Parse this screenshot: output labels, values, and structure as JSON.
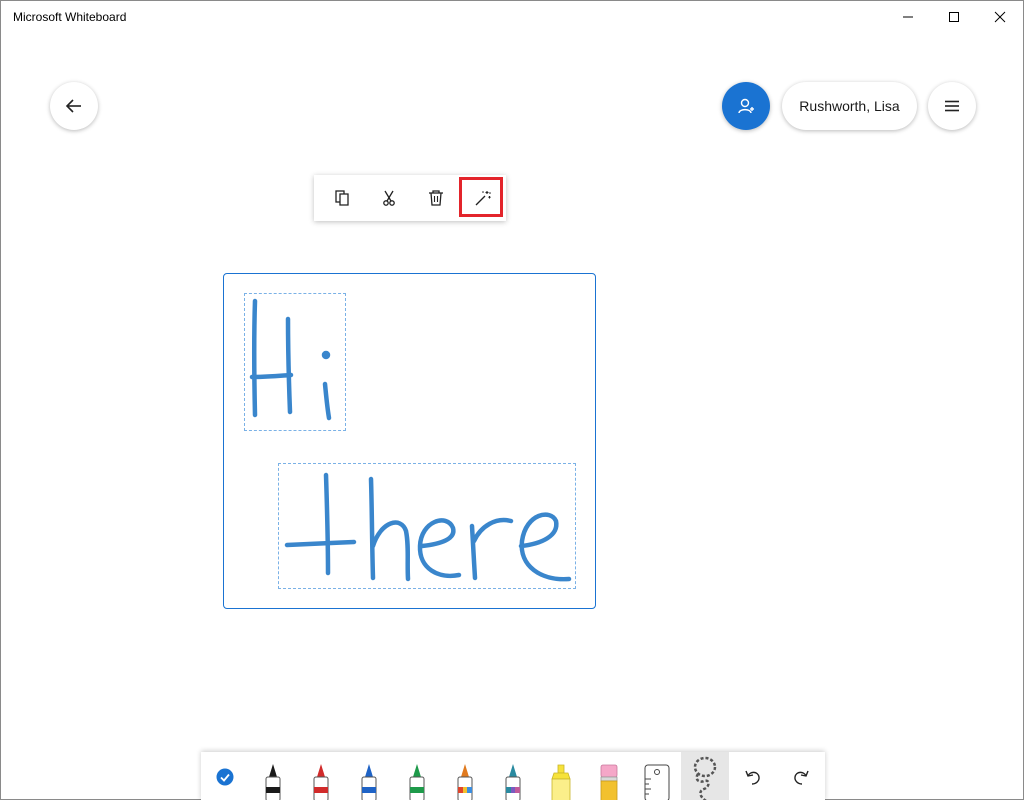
{
  "window": {
    "title": "Microsoft Whiteboard",
    "controls": [
      "minimize-icon",
      "maximize-icon",
      "close-icon"
    ]
  },
  "header": {
    "back_icon": "back-arrow-icon",
    "invite_icon": "add-person-icon",
    "user_name": "Rushworth, Lisa",
    "menu_icon": "hamburger-menu-icon"
  },
  "context_toolbar": {
    "items": [
      {
        "name": "copy",
        "icon": "copy-icon"
      },
      {
        "name": "cut",
        "icon": "scissors-icon"
      },
      {
        "name": "delete",
        "icon": "trash-icon"
      },
      {
        "name": "ink-beautify",
        "icon": "magic-wand-icon",
        "highlighted": true
      }
    ],
    "highlight_color": "#e3242b"
  },
  "selection": {
    "ink_words": [
      "Hi",
      "there"
    ],
    "ink_color": "#3a86cc",
    "frame_color": "#1a73d2"
  },
  "bottom_toolbar": {
    "items": [
      {
        "name": "select",
        "icon": "check-circle-icon"
      },
      {
        "name": "pen-black",
        "icon": "pen-icon",
        "color": "#1a1a1a"
      },
      {
        "name": "pen-red",
        "icon": "pen-icon",
        "color": "#d12b2b"
      },
      {
        "name": "pen-blue",
        "icon": "pen-icon",
        "color": "#1f63c6"
      },
      {
        "name": "pen-green",
        "icon": "pen-icon",
        "color": "#1e9a4a"
      },
      {
        "name": "pen-rainbow",
        "icon": "pen-icon",
        "color": "#e07a1f"
      },
      {
        "name": "pen-galaxy",
        "icon": "pen-icon",
        "color": "#2a8aa0"
      },
      {
        "name": "highlighter",
        "icon": "highlighter-icon",
        "color": "#f6e23a"
      },
      {
        "name": "eraser",
        "icon": "eraser-icon",
        "color": "#f5a7c8"
      },
      {
        "name": "ruler",
        "icon": "ruler-icon"
      },
      {
        "name": "lasso",
        "icon": "lasso-icon",
        "active": true
      },
      {
        "name": "undo",
        "icon": "undo-icon"
      },
      {
        "name": "redo",
        "icon": "redo-icon"
      }
    ]
  }
}
